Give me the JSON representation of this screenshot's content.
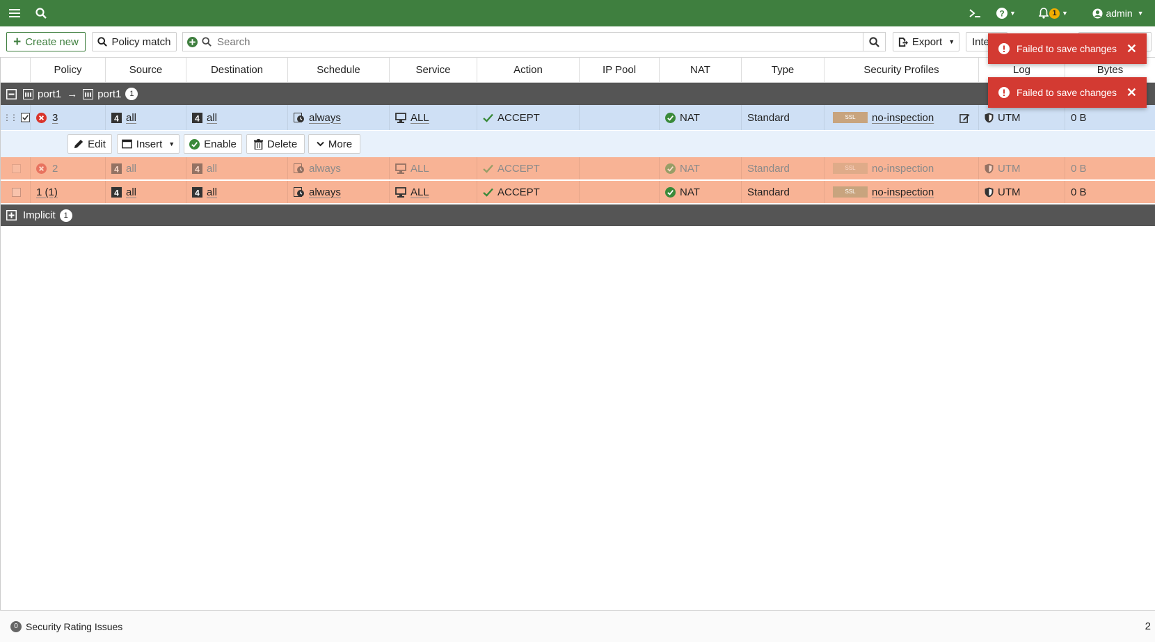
{
  "topbar": {
    "user": "admin",
    "notif_count": "1"
  },
  "toolbar": {
    "create_label": "Create new",
    "policy_match_label": "Policy match",
    "search_placeholder": "Search",
    "export_label": "Export",
    "interface_label": "Inte"
  },
  "columns": [
    "Policy",
    "Source",
    "Destination",
    "Schedule",
    "Service",
    "Action",
    "IP Pool",
    "NAT",
    "Type",
    "Security Profiles",
    "Log",
    "Bytes"
  ],
  "group": {
    "from": "port1",
    "arrow": "→",
    "to": "port1",
    "count": "1"
  },
  "rows": [
    {
      "policy": "3",
      "source": "all",
      "destination": "all",
      "schedule": "always",
      "service": "ALL",
      "action": "ACCEPT",
      "ip_pool": "",
      "nat": "NAT",
      "type": "Standard",
      "ssl": "SSL",
      "profile": "no-inspection",
      "log": "UTM",
      "bytes": "0 B"
    },
    {
      "policy": "2",
      "source": "all",
      "destination": "all",
      "schedule": "always",
      "service": "ALL",
      "action": "ACCEPT",
      "ip_pool": "",
      "nat": "NAT",
      "type": "Standard",
      "ssl": "SSL",
      "profile": "no-inspection",
      "log": "UTM",
      "bytes": "0 B"
    },
    {
      "policy": "1 (1)",
      "source": "all",
      "destination": "all",
      "schedule": "always",
      "service": "ALL",
      "action": "ACCEPT",
      "ip_pool": "",
      "nat": "NAT",
      "type": "Standard",
      "ssl": "SSL",
      "profile": "no-inspection",
      "log": "UTM",
      "bytes": "0 B"
    }
  ],
  "row_actions": {
    "edit": "Edit",
    "insert": "Insert",
    "enable": "Enable",
    "delete": "Delete",
    "more": "More"
  },
  "implicit": {
    "label": "Implicit",
    "count": "1"
  },
  "toasts": [
    "Failed to save changes",
    "Failed to save changes"
  ],
  "status": {
    "security_rating_count": "0",
    "security_rating_label": "Security Rating Issues",
    "total": "2"
  },
  "colors": {
    "topbar": "#3f7f3f",
    "group": "#555555",
    "selected_row": "#cfe0f5",
    "error_row": "#f8b395",
    "toast": "#d33a32"
  }
}
